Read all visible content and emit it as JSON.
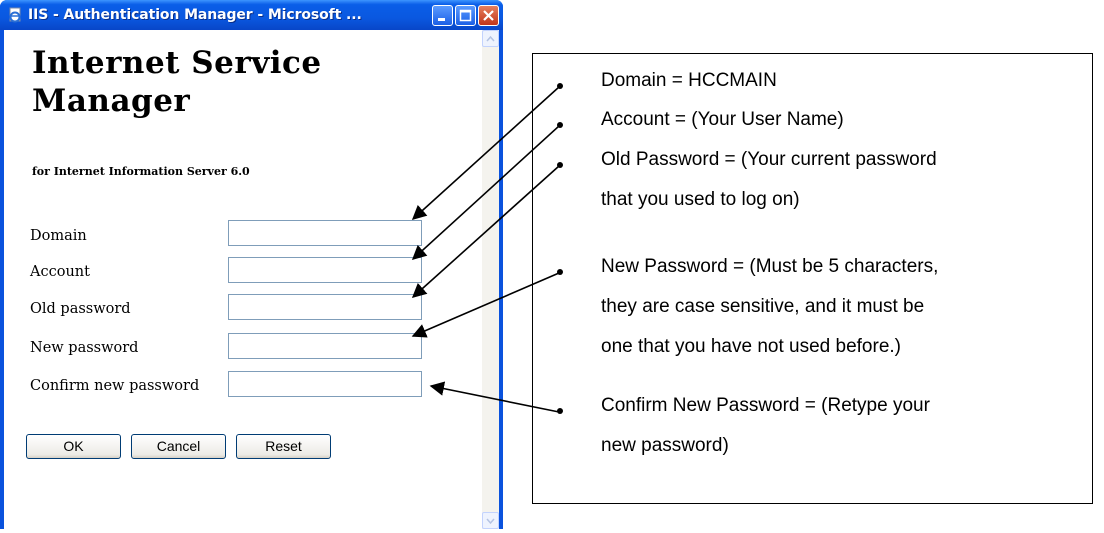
{
  "window": {
    "title": "IIS - Authentication Manager - Microsoft ...",
    "heading": "Internet Service Manager",
    "subheading": "for Internet Information Server 6.0"
  },
  "form": {
    "fields": [
      {
        "label": "Domain",
        "value": ""
      },
      {
        "label": "Account",
        "value": ""
      },
      {
        "label": "Old password",
        "value": ""
      },
      {
        "label": "New password",
        "value": ""
      },
      {
        "label": "Confirm new password",
        "value": ""
      }
    ],
    "buttons": {
      "ok": "OK",
      "cancel": "Cancel",
      "reset": "Reset"
    }
  },
  "annotations": [
    "Domain = HCCMAIN",
    "Account = (Your User Name)",
    "Old Password = (Your current password",
    "that you used to log on)",
    "New Password = (Must be 5 characters,",
    "they are case sensitive, and it must be",
    "one that you have not used before.)",
    "Confirm New Password = (Retype your",
    "new password)"
  ],
  "icons": {
    "app": "ie-page-icon",
    "minimize": "minimize-icon",
    "maximize": "maximize-icon",
    "close": "close-icon"
  }
}
